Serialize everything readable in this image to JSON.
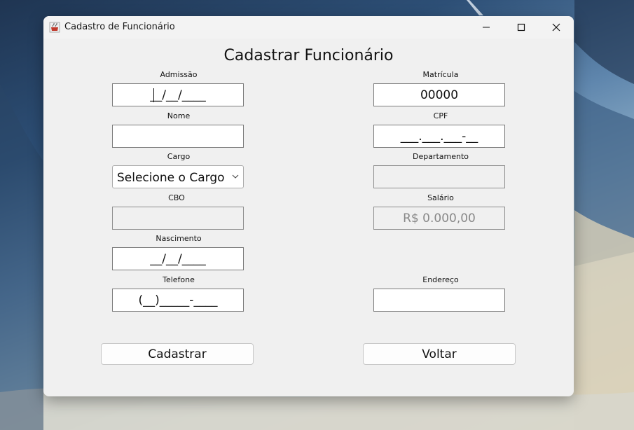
{
  "window": {
    "title": "Cadastro de Funcionário",
    "icon": "java-cup-icon",
    "controls": [
      "minimize-icon",
      "maximize-icon",
      "close-icon"
    ]
  },
  "form": {
    "heading": "Cadastrar Funcionário",
    "admissao": {
      "label": "Admissão",
      "value": "__/__/____"
    },
    "matricula": {
      "label": "Matrícula",
      "value": "00000"
    },
    "nome": {
      "label": "Nome",
      "value": ""
    },
    "cpf": {
      "label": "CPF",
      "value": "___.___.___-__"
    },
    "cargo": {
      "label": "Cargo",
      "selected": "Selecione o Cargo"
    },
    "departamento": {
      "label": "Departamento",
      "value": ""
    },
    "cbo": {
      "label": "CBO",
      "value": ""
    },
    "salario": {
      "label": "Salário",
      "value": "R$ 0.000,00"
    },
    "nascimento": {
      "label": "Nascimento",
      "value": "__/__/____"
    },
    "telefone": {
      "label": "Telefone",
      "value": "(__)_____-____"
    },
    "endereco": {
      "label": "Endereço",
      "value": ""
    }
  },
  "buttons": {
    "cadastrar": "Cadastrar",
    "voltar": "Voltar"
  }
}
